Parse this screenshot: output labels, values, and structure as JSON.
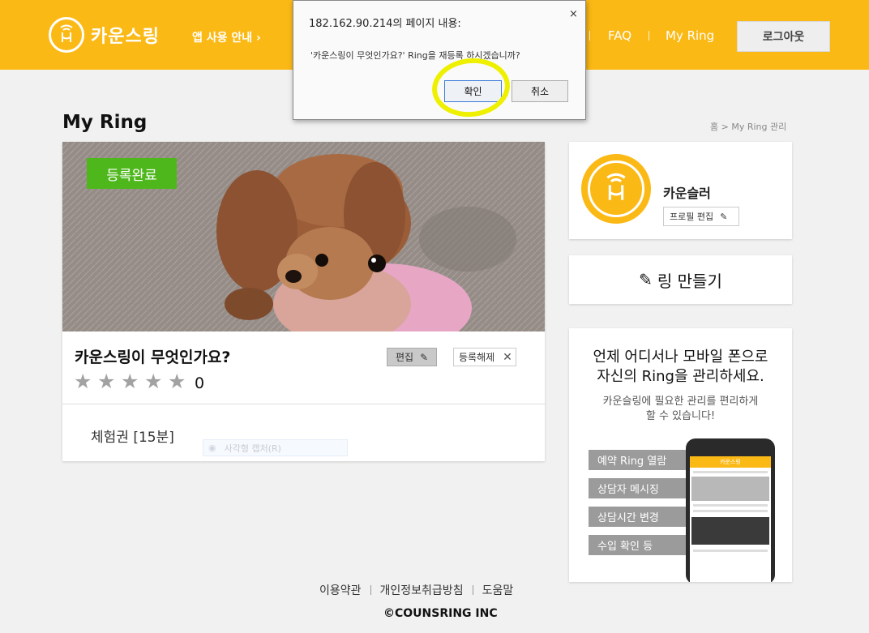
{
  "header": {
    "brand": "카운스링",
    "nav_app_guide": "앱 사용 안내 ›",
    "nav_faq": "FAQ",
    "nav_myring": "My Ring",
    "logout": "로그아웃"
  },
  "page": {
    "title": "My Ring",
    "breadcrumb": "홈 > My Ring 관리"
  },
  "ring_card": {
    "status_badge": "등록완료",
    "title": "카운스링이 무엇인가요?",
    "edit_label": "편집",
    "unregister_label": "등록해제",
    "rating_count": "0",
    "stars_filled": 0,
    "stars_total": 5,
    "ticket": "체험권 [15분]",
    "ghost_text": "사각형 캡처(R)"
  },
  "profile": {
    "name": "카운슬러",
    "edit_label": "프로필 편집"
  },
  "make_ring_label": "링 만들기",
  "promo": {
    "headline_1": "언제 어디서나 모바일 폰으로",
    "headline_2": "자신의 Ring을 관리하세요.",
    "sub_1": "카운슬링에 필요한 관리를 편리하게",
    "sub_2": "할 수 있습니다!",
    "features": [
      "예약 Ring 열람",
      "상담자 메시징",
      "상담시간 변경",
      "수입 확인 등"
    ],
    "phone_app_name": "카운스링"
  },
  "footer": {
    "links": [
      "이용약관",
      "개인정보취급방침",
      "도움말"
    ],
    "copyright": "©COUNSRING INC"
  },
  "dialog": {
    "title": "182.162.90.214의 페이지 내용:",
    "close": "×",
    "message": "'카운스링이 무엇인가요?' Ring을 재등록 하시겠습니까?",
    "ok": "확인",
    "cancel": "취소"
  },
  "colors": {
    "brand_yellow": "#fbb916",
    "badge_green": "#4eb71c",
    "highlight": "#eef000"
  }
}
